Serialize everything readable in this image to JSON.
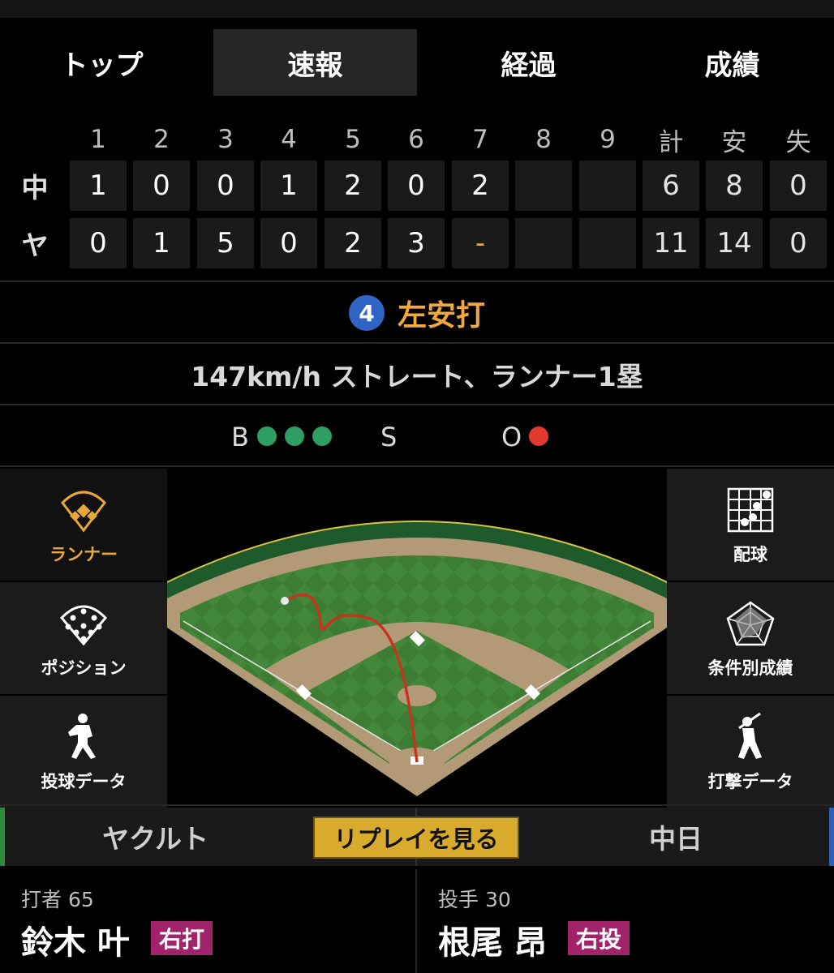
{
  "tabs": [
    {
      "label": "トップ"
    },
    {
      "label": "速報"
    },
    {
      "label": "経過"
    },
    {
      "label": "成績"
    }
  ],
  "active_tab": 1,
  "scoreboard": {
    "headers": [
      "1",
      "2",
      "3",
      "4",
      "5",
      "6",
      "7",
      "8",
      "9",
      "計",
      "安",
      "失"
    ],
    "teams": [
      {
        "name": "中",
        "innings": [
          "1",
          "0",
          "0",
          "1",
          "2",
          "0",
          "2",
          "",
          ""
        ],
        "runs": "6",
        "hits": "8",
        "errors": "0"
      },
      {
        "name": "ヤ",
        "innings": [
          "0",
          "1",
          "5",
          "0",
          "2",
          "3",
          "-",
          "",
          ""
        ],
        "runs": "11",
        "hits": "14",
        "errors": "0"
      }
    ]
  },
  "play": {
    "number": "4",
    "result": "左安打"
  },
  "pitch_info": "147km/h ストレート、ランナー1塁",
  "count": {
    "b_label": "B",
    "s_label": "S",
    "o_label": "O",
    "balls": 3,
    "strikes": 0,
    "outs": 1,
    "ball_color": "#2f9e62",
    "out_color": "#e03a2f"
  },
  "side_left": [
    {
      "label": "ランナー",
      "icon": "runner-diamond-icon"
    },
    {
      "label": "ポジション",
      "icon": "position-icon"
    },
    {
      "label": "投球データ",
      "icon": "pitcher-icon"
    }
  ],
  "side_right": [
    {
      "label": "配球",
      "icon": "pitch-grid-icon"
    },
    {
      "label": "条件別成績",
      "icon": "radar-chart-icon"
    },
    {
      "label": "打撃データ",
      "icon": "batter-icon"
    }
  ],
  "replay": {
    "home_team": "ヤクルト",
    "button": "リプレイを見る",
    "away_team": "中日"
  },
  "batter": {
    "label": "打者 65",
    "name": "鈴木 叶",
    "tag": "右打"
  },
  "pitcher": {
    "label": "投手 30",
    "name": "根尾 昂",
    "tag": "右投"
  },
  "colors": {
    "accent": "#e8a838",
    "tag": "#a1246a",
    "replay": "#d9ab2c"
  }
}
